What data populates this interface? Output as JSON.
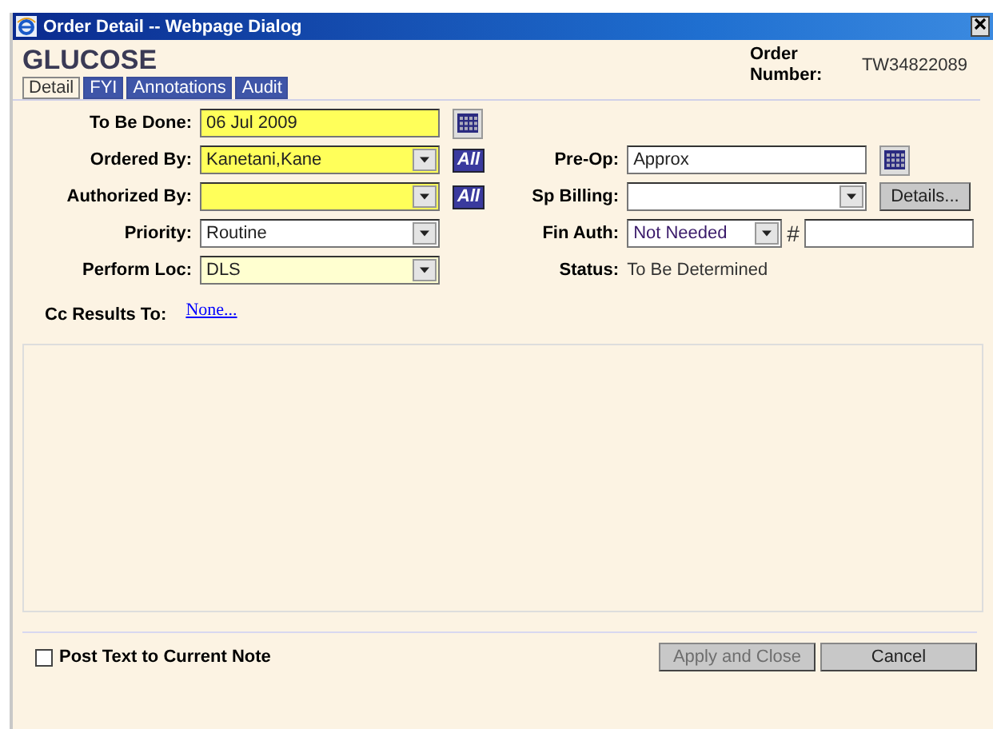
{
  "window": {
    "title": "Order Detail -- Webpage Dialog"
  },
  "header": {
    "title": "GLUCOSE",
    "order_number_label": "Order Number:",
    "order_number": "TW34822089"
  },
  "tabs": [
    {
      "label": "Detail",
      "selected": true
    },
    {
      "label": "FYI",
      "selected": false
    },
    {
      "label": "Annotations",
      "selected": false
    },
    {
      "label": "Audit",
      "selected": false
    }
  ],
  "left_fields": [
    {
      "kind": "date",
      "label": "To Be Done:",
      "value": "06 Jul 2009",
      "required": true,
      "defaulted": false
    },
    {
      "kind": "select",
      "label": "Ordered By:",
      "value": "Kanetani,Kane",
      "required": true,
      "defaulted": false,
      "button": "All"
    },
    {
      "kind": "select",
      "label": "Authorized By:",
      "required": true,
      "defaulted": false,
      "button": "All"
    },
    {
      "kind": "select",
      "label": "Priority:",
      "value": "Routine",
      "required": false,
      "defaulted": false
    },
    {
      "kind": "select",
      "label": "Perform Loc:",
      "value": "DLS",
      "required": false,
      "defaulted": true
    }
  ],
  "right_fields": [
    {
      "kind": "date",
      "label": "Pre-Op:",
      "value": "Approx"
    },
    {
      "kind": "select",
      "label": "Sp Billing:",
      "button": "Details..."
    },
    {
      "kind": "auth",
      "label": "Fin Auth:",
      "value": "Not Needed",
      "extra": "#"
    },
    {
      "kind": "text",
      "label": "Status:",
      "value": "To Be Determined"
    }
  ],
  "cc_results": {
    "label": "Cc Results To:",
    "link": "None..."
  },
  "footer": {
    "checkbox": {
      "label": "Post Text to Current Note",
      "checked": false
    },
    "buttons": [
      {
        "label": "Apply and Close",
        "disabled": true
      },
      {
        "label": "Cancel",
        "disabled": false
      }
    ]
  }
}
